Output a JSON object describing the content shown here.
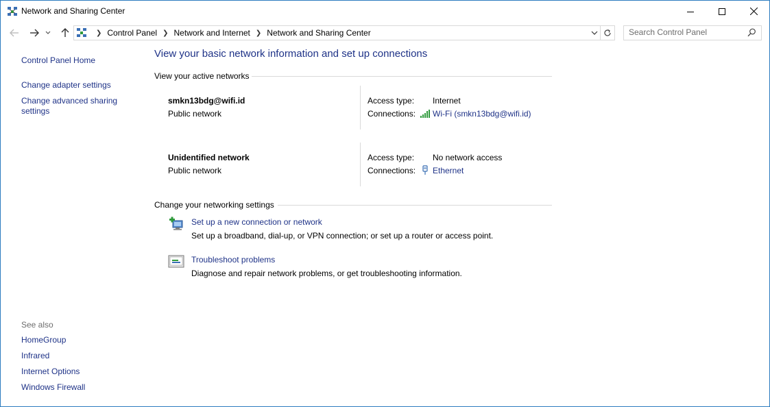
{
  "window": {
    "title": "Network and Sharing Center",
    "icon": "network-center-icon"
  },
  "address": {
    "crumbs": [
      "Control Panel",
      "Network and Internet",
      "Network and Sharing Center"
    ],
    "search_placeholder": "Search Control Panel"
  },
  "left_pane": {
    "home": "Control Panel Home",
    "links": [
      "Change adapter settings",
      "Change advanced sharing",
      "settings"
    ],
    "see_also_label": "See also",
    "see_also": [
      "HomeGroup",
      "Infrared",
      "Internet Options",
      "Windows Firewall"
    ]
  },
  "main": {
    "title": "View your basic network information and set up connections",
    "active_networks_heading": "View your active networks",
    "networks": [
      {
        "name": "smkn13bdg@wifi.id",
        "type": "Public network",
        "access_label": "Access type:",
        "access_value": "Internet",
        "connections_label": "Connections:",
        "connection": "Wi-Fi (smkn13bdg@wifi.id)",
        "connection_icon": "wifi-signal-icon"
      },
      {
        "name": "Unidentified network",
        "type": "Public network",
        "access_label": "Access type:",
        "access_value": "No network access",
        "connections_label": "Connections:",
        "connection": "Ethernet",
        "connection_icon": "ethernet-icon"
      }
    ],
    "settings_heading": "Change your networking settings",
    "tasks": [
      {
        "link": "Set up a new connection or network",
        "desc": "Set up a broadband, dial-up, or VPN connection; or set up a router or access point.",
        "icon": "new-connection-icon"
      },
      {
        "link": "Troubleshoot problems",
        "desc": "Diagnose and repair network problems, or get troubleshooting information.",
        "icon": "troubleshoot-icon"
      }
    ]
  },
  "colors": {
    "link": "#1e3287",
    "title": "#1e3287",
    "border": "#2b7bbf",
    "divider": "#d9d9d9",
    "muted": "#6d6d6d"
  }
}
